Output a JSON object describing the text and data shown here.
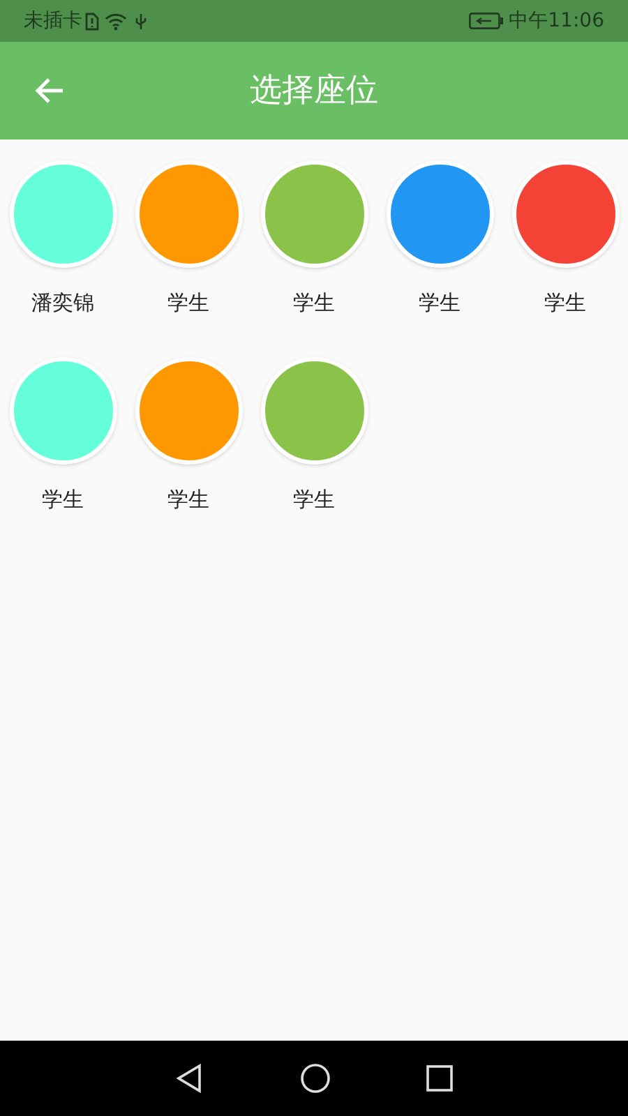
{
  "status_bar": {
    "carrier": "未插卡",
    "time": "中午11:06"
  },
  "app_bar": {
    "title": "选择座位"
  },
  "seats": [
    {
      "name": "潘奕锦",
      "color": "#64ffda"
    },
    {
      "name": "学生",
      "color": "#ff9800"
    },
    {
      "name": "学生",
      "color": "#8bc34a"
    },
    {
      "name": "学生",
      "color": "#2196f3"
    },
    {
      "name": "学生",
      "color": "#f44336"
    },
    {
      "name": "学生",
      "color": "#64ffda"
    },
    {
      "name": "学生",
      "color": "#ff9800"
    },
    {
      "name": "学生",
      "color": "#8bc34a"
    }
  ]
}
